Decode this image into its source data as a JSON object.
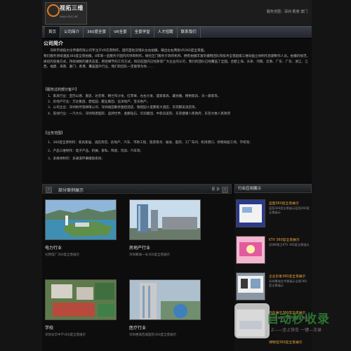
{
  "header": {
    "logo_text": "视拓三维",
    "logo_url": "www.stvr.net",
    "service": "服务范围：深圳  香港  澳门"
  },
  "nav": {
    "items": [
      "首页",
      "公司简介",
      "360度全景",
      "VR全景",
      "全景学堂",
      "人才招聘",
      "联系我们"
    ]
  },
  "intro": {
    "title": "公司简介",
    "p1": "　　深圳市视拓文化传播有限公司专注于VR实景制作，国内首批双镜头左右拍摄，输出左右两张VR360度全景图。",
    "p2": "我们服务领域涵盖360度全景拍摄，8年来一直服务于国内的项目制作，微社区门服务于政府机构、拥有拍摄丰富的摄制团队和技术全景超级三维动画立体制作后期制作人员。拍摄的规范，质控的思维方式，持续绒格的服务态度，把控细节的工作方式。目前在国内已经获得广大企业的认可，我们的团队已经覆盖了全国。合肥上海、天津、河南、云南、广东、广东、浙江、江西、福建、海南、厦门、香港、覆盖国外行业，我们的团队一定能够为你……"
  },
  "business": {
    "title": "【服务过的部分客户】",
    "items": [
      "1、家具行业：亚历山德、嘉思、达芬奇、精兰布沙龙、红苹果、左右沙发、盛家家具、藏坊雅、精致家具、天一嘉家等。",
      "2、房地产行业：万达集团、碧桂园、鲲业集团、远洋地产、宝光地产。",
      "3、公司企业：深圳依然电梯限公司、深圳福田奢侈图控酒店、敬祖园十度都家大酒店、东莞都美酒店等。",
      "4、其他行业：一汽大众、深圳和唐医院、品牌世界、金鹏钻石、华润集团、中影良美院、东莞健康人民政府、东莞大数人民政府"
    ]
  },
  "scope": {
    "title": "【业务范围】",
    "items": [
      "1、360度全景制作：家具家居、酒店宾馆、房地产、汽车、市政工程、旅游景点、展会、医院、工厂车间、机场港口、购物商超工场、学校等;",
      "2、产品三维制作：电子产品、机械、家私、陶瓷、玩具、汽车等;",
      "3、多媒体制作：多通道环幕播放系统;"
    ]
  },
  "cases": {
    "title": "部分案例展示",
    "more": "更  多",
    "prev": "‹",
    "next": "›",
    "items": [
      {
        "name": "电力行业",
        "desc": "论网电厂360度全景展示"
      },
      {
        "name": "房地产行业",
        "desc": "深圳鹏城一号360度全景展示"
      },
      {
        "name": "学校",
        "desc": "深圳龙华中学360度全景展示"
      },
      {
        "name": "医疗行业",
        "desc": "深圳惠城百威医院360度全景展示"
      }
    ]
  },
  "sidebar": {
    "title": "行业应用展示",
    "items": [
      {
        "title": "蓝图360度全景展示",
        "text": "蓝图360度全景展示蓝图360度全景展示"
      },
      {
        "title": "KTV 360度全景展示",
        "text": "深圳K歌王KTV 360度全景展示"
      },
      {
        "title": "企业形象360度全景展示",
        "text": "深圳惠城艺术景展示全景360度全景展示"
      },
      {
        "title": "汽车展示360度全景展示",
        "text": "深圳惠城3C汽车360度全景展示"
      },
      {
        "title": "博物馆360度全景展示",
        "text": ""
      }
    ]
  },
  "watermark": {
    "title": "自动秒收录",
    "sub": "Z——坐上快车 一键—次录"
  }
}
